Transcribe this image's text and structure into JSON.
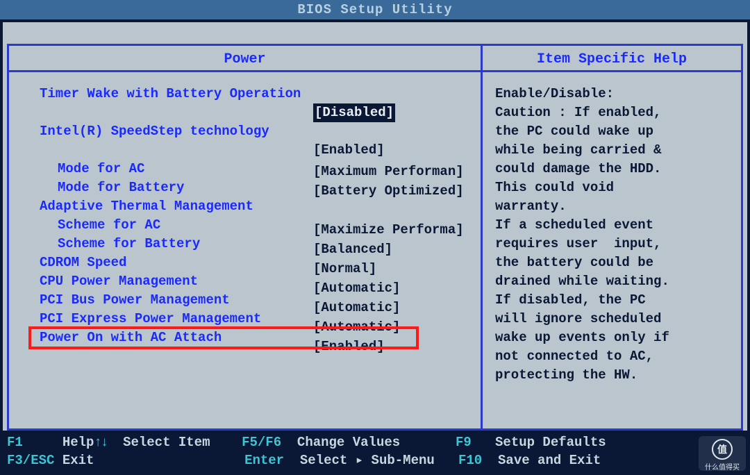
{
  "title": "BIOS Setup Utility",
  "left": {
    "header": "Power",
    "items": [
      {
        "label": "Timer Wake with Battery Operation",
        "value": "[Disabled]",
        "indent": 1,
        "selected": true,
        "value_below": true
      },
      {
        "label": "Intel(R) SpeedStep technology",
        "value": "[Enabled]",
        "indent": 1,
        "value_below": true
      },
      {
        "label": "Mode for AC",
        "value": "[Maximum Performan]",
        "indent": 2
      },
      {
        "label": "Mode for Battery",
        "value": "[Battery Optimized]",
        "indent": 2
      },
      {
        "label": "Adaptive Thermal Management",
        "value": "",
        "indent": 1
      },
      {
        "label": "Scheme for AC",
        "value": "[Maximize Performa]",
        "indent": 2
      },
      {
        "label": "Scheme for Battery",
        "value": "[Balanced]",
        "indent": 2
      },
      {
        "label": "CDROM Speed",
        "value": "[Normal]",
        "indent": 1
      },
      {
        "label": "CPU Power Management",
        "value": "[Automatic]",
        "indent": 1
      },
      {
        "label": "PCI Bus Power Management",
        "value": "[Automatic]",
        "indent": 1
      },
      {
        "label": "PCI Express Power Management",
        "value": "[Automatic]",
        "indent": 1
      },
      {
        "label": "Power On with AC Attach",
        "value": "[Enabled]",
        "indent": 1,
        "boxed": true
      }
    ]
  },
  "right": {
    "header": "Item Specific Help",
    "help": "Enable/Disable:\nCaution : If enabled,\nthe PC could wake up\nwhile being carried &\ncould damage the HDD.\nThis could void\nwarranty.\nIf a scheduled event\nrequires user  input,\nthe battery could be\ndrained while waiting.\nIf disabled, the PC\nwill ignore scheduled\nwake up events only if\nnot connected to AC,\nprotecting the HW."
  },
  "footer": {
    "f1": "F1",
    "help": "Help",
    "arrows": "↑↓",
    "select_item": "Select Item",
    "f5f6": "F5/F6",
    "change_values": "Change Values",
    "f9": "F9",
    "setup_defaults": "Setup Defaults",
    "f3esc": "F3/ESC",
    "exit": "Exit",
    "enter": "Enter",
    "select_sub": "Select ▸ Sub-Menu",
    "f10": "F10",
    "save_exit": "Save and Exit"
  },
  "watermark": {
    "icon": "值",
    "text": "什么值得买"
  }
}
